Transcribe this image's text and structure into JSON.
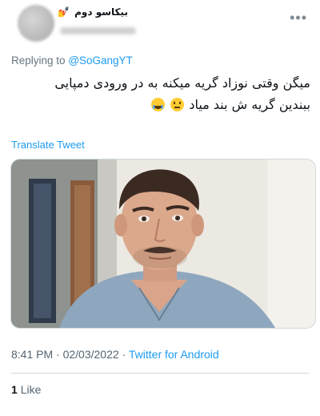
{
  "tweet": {
    "display_name": "بیکاسو دوم",
    "name_emoji": "💅",
    "reply_prefix": "Replying to",
    "reply_handle": "@SoGangYT",
    "text_line1": "میگن وقتی نوزاد گریه میکنه به در ورودی دمپایی",
    "text_line2": "ببندین گریه ش بند میاد",
    "emojis": [
      "neutral-face-icon",
      "face-with-tears-of-joy-icon"
    ],
    "translate_label": "Translate Tweet",
    "time": "8:41 PM",
    "date": "02/03/2022",
    "separator": "·",
    "source": "Twitter for Android",
    "like_count": "1",
    "like_label": "Like"
  },
  "colors": {
    "link": "#1d9bf0",
    "secondary_text": "#536471",
    "primary_text": "#0f1419"
  }
}
